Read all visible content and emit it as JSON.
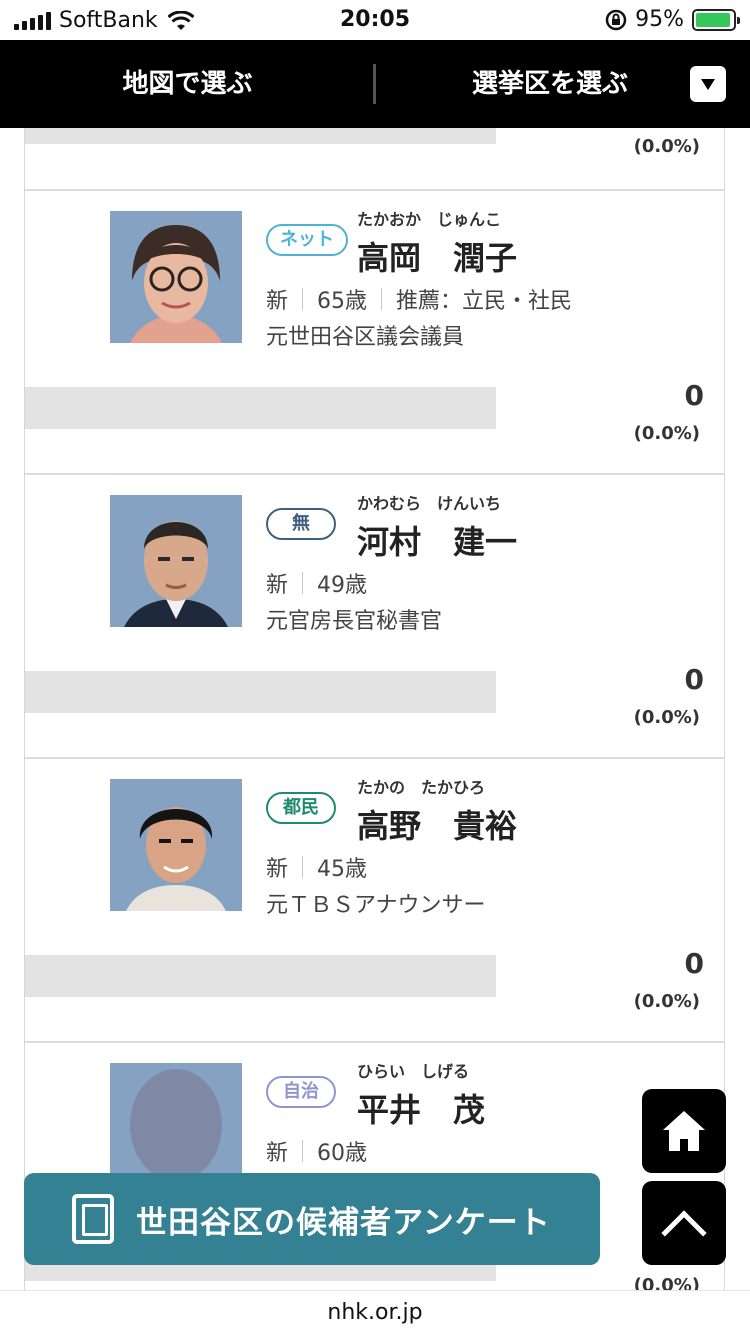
{
  "status_bar": {
    "carrier": "SoftBank",
    "time": "20:05",
    "battery": "95%"
  },
  "nav": {
    "tab_map": "地図で選ぶ",
    "tab_district": "選挙区を選ぶ"
  },
  "top_partial": {
    "pct": "(0.0%)"
  },
  "candidates": [
    {
      "party": "ネット",
      "party_color": "#4fb3d9",
      "furigana": "たかおか　じゅんこ",
      "name": "高岡　潤子",
      "status": "新",
      "age": "65歳",
      "endorse": "推薦：立民・社民",
      "career": "元世田谷区議会議員",
      "votes": "0",
      "pct": "(0.0%)"
    },
    {
      "party": "無",
      "party_color": "#40607f",
      "furigana": "かわむら　けんいち",
      "name": "河村　建一",
      "status": "新",
      "age": "49歳",
      "career": "元官房長官秘書官",
      "votes": "0",
      "pct": "(0.0%)"
    },
    {
      "party": "都民",
      "party_color": "#1f8a6e",
      "furigana": "たかの　たかひろ",
      "name": "高野　貴裕",
      "status": "新",
      "age": "45歳",
      "career": "元ＴＢＳアナウンサー",
      "votes": "0",
      "pct": "(0.0%)"
    },
    {
      "party": "自治",
      "party_color": "#8f96cf",
      "furigana": "ひらい　しげる",
      "name": "平井　茂",
      "status": "新",
      "age": "60歳",
      "career": "",
      "votes": "",
      "pct": "(0.0%)"
    }
  ],
  "survey_button": "世田谷区の候補者アンケート",
  "url": "nhk.or.jp"
}
